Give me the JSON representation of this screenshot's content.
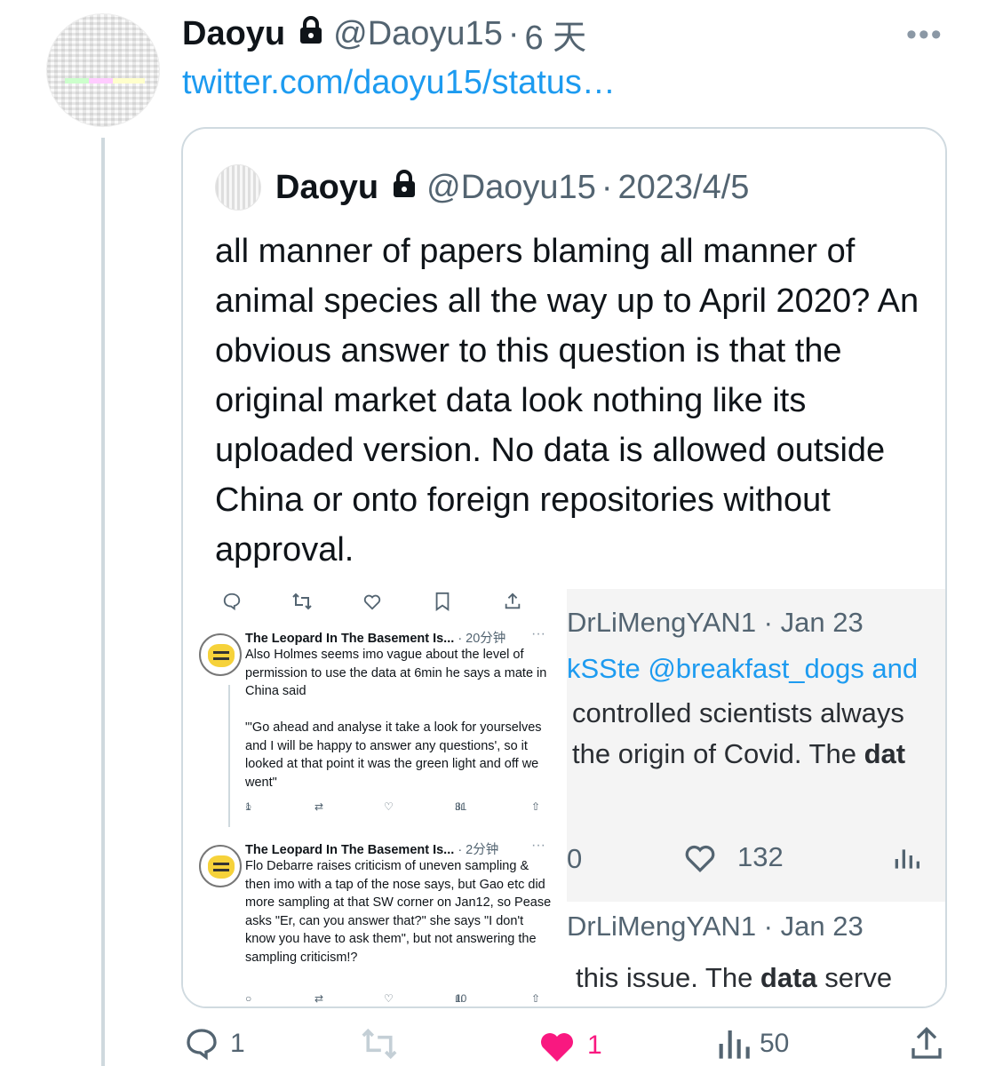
{
  "tweet": {
    "author_name": "Daoyu",
    "handle": "@Daoyu15",
    "time": "6 天",
    "link_text": "twitter.com/daoyu15/status…",
    "more_icon": "ellipsis-icon"
  },
  "quote": {
    "author_name": "Daoyu",
    "handle": "@Daoyu15",
    "date": "2023/4/5",
    "text": "all manner of papers blaming all manner of animal species all the way up to April 2020? An obvious answer to this question is that the original market data look nothing like its uploaded version. No data is allowed outside China or onto foreign repositories without approval."
  },
  "media_left": {
    "replies": [
      {
        "name": "The Leopard In The Basement Is...",
        "time": "· 20分钟",
        "text": "Also Holmes seems imo vague about the level of permission to use the data at 6min he says a mate in China said\n\n\"'Go ahead and analyse it take a look for yourselves and I will be happy to answer any questions', so it looked at that point it was the green light and off we went\"",
        "reply_count": "1",
        "view_count": "31"
      },
      {
        "name": "The Leopard In The Basement Is...",
        "time": "· 2分钟",
        "text": "Flo Debarre raises criticism of uneven sampling & then imo with a tap of the nose says, but Gao etc did more sampling at that SW corner on Jan12, so Pease asks \"Er, can you answer that?\" she says \"I don't know you have to ask them\", but not answering the sampling criticism!?",
        "reply_count": "",
        "view_count": "10"
      }
    ]
  },
  "media_right": {
    "row1_meta": "DrLiMengYAN1 · Jan 23",
    "row2_blue": "kSSte @breakfast_dogs and",
    "row3": "controlled scientists always",
    "row4_pre": "the origin of Covid. The ",
    "row4_bold": "dat",
    "stat_left": "0",
    "like_count": "132",
    "row5_meta": "DrLiMengYAN1 · Jan 23",
    "row6_pre": "this issue. The ",
    "row6_bold": "data",
    "row6_post": " serve"
  },
  "actions": {
    "reply_count": "1",
    "retweet_count": "",
    "like_count": "1",
    "view_count": "50"
  },
  "colors": {
    "link": "#1d9bf0",
    "like_active": "#f91880",
    "muted": "#536471"
  }
}
